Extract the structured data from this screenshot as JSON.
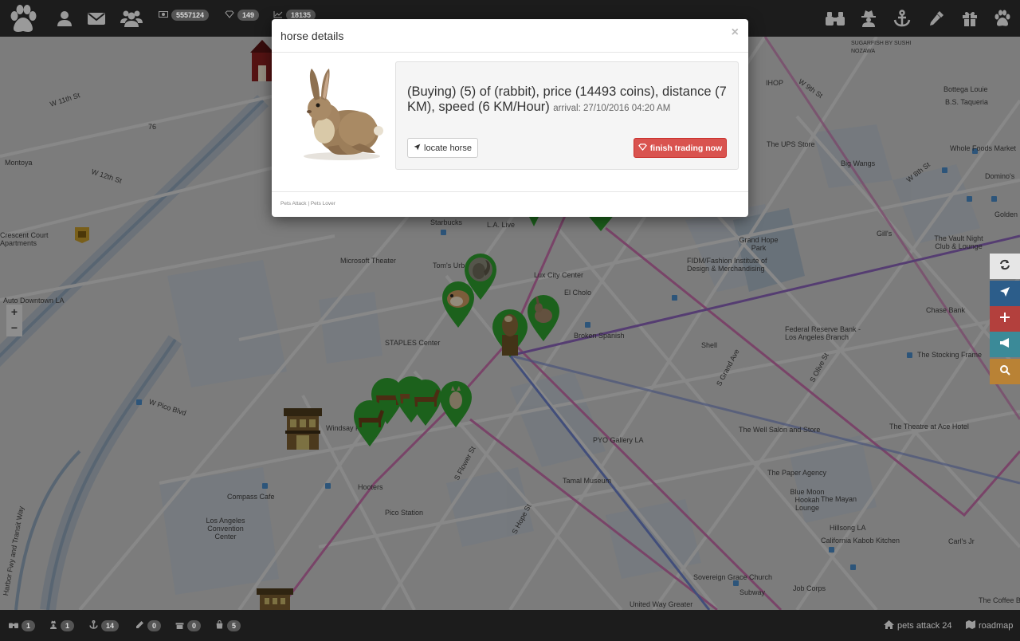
{
  "topbar": {
    "icons_left": [
      "paw-icon",
      "user-icon",
      "envelope-icon",
      "users-icon"
    ],
    "stats": [
      {
        "icon": "money-icon",
        "value": "5557124"
      },
      {
        "icon": "diamond-icon",
        "value": "149"
      },
      {
        "icon": "chart-icon",
        "value": "18135"
      }
    ],
    "icons_right": [
      "binoculars-icon",
      "user-secret-icon",
      "anchor-icon",
      "eyedropper-icon",
      "gift-icon",
      "paw-icon"
    ]
  },
  "modal": {
    "title": "horse details",
    "close": "×",
    "main_text": "(Buying) (5) of (rabbit), price (14493 coins), distance (7 KM), speed (6 KM/Hour)",
    "arrival_text": "arrival: 27/10/2016 04:20 AM",
    "locate_label": "locate horse",
    "finish_label": "finish trading now",
    "footer": "Pets Attack | Pets Lover"
  },
  "map": {
    "labels": [
      {
        "text": "Microsoft Theater"
      },
      {
        "text": "STAPLES Center"
      },
      {
        "text": "Tom's Urban"
      },
      {
        "text": "Lux City Center"
      },
      {
        "text": "El Cholo"
      },
      {
        "text": "Broken Spanish"
      },
      {
        "text": "L.A. Live"
      },
      {
        "text": "Starbucks"
      },
      {
        "text": "Grand Hope Park"
      },
      {
        "text": "FIDM/Fashion Institute of Design & Merchandising"
      },
      {
        "text": "Federal Reserve Bank - Los Angeles Branch"
      },
      {
        "text": "Chase Bank"
      },
      {
        "text": "The Stocking Frame"
      },
      {
        "text": "Shell"
      },
      {
        "text": "The Well Salon and Store"
      },
      {
        "text": "The Theatre at Ace Hotel"
      },
      {
        "text": "PYO Gallery LA"
      },
      {
        "text": "The Paper Agency"
      },
      {
        "text": "Blue Moon Hookah Lounge"
      },
      {
        "text": "The Mayan"
      },
      {
        "text": "Hillsong LA"
      },
      {
        "text": "California Kabob Kitchen"
      },
      {
        "text": "Carl's Jr"
      },
      {
        "text": "Tamal Museum"
      },
      {
        "text": "Hooters"
      },
      {
        "text": "Pico Station"
      },
      {
        "text": "Compass Cafe"
      },
      {
        "text": "Los Angeles Convention Center"
      },
      {
        "text": "Sovereign Grace Church"
      },
      {
        "text": "Subway"
      },
      {
        "text": "Job Corps"
      },
      {
        "text": "United Way Greater"
      },
      {
        "text": "The Coffee Bean"
      },
      {
        "text": "Big Wangs"
      },
      {
        "text": "Gill's"
      },
      {
        "text": "The Vault Night Club & Lounge"
      },
      {
        "text": "Golden"
      },
      {
        "text": "Domino's"
      },
      {
        "text": "Whole Foods Market"
      },
      {
        "text": "The UPS Store"
      },
      {
        "text": "Bottega Louie"
      },
      {
        "text": "B.S. Taqueria"
      },
      {
        "text": "SUGARFISH BY SUSHI NOZAWA"
      },
      {
        "text": "IHOP"
      },
      {
        "text": "Auto Downtown LA"
      },
      {
        "text": "Crescent Court Apartments"
      },
      {
        "text": "Montoya"
      },
      {
        "text": "Windsay Plaza"
      },
      {
        "text": "Harbor Fwy and Transit Way"
      },
      {
        "text": "W Pico Blvd"
      },
      {
        "text": "W 11th St"
      },
      {
        "text": "W 12th St"
      },
      {
        "text": "S Flower St"
      },
      {
        "text": "S Grand Ave"
      },
      {
        "text": "S Hope St"
      },
      {
        "text": "S Olive St"
      },
      {
        "text": "W 9th St"
      },
      {
        "text": "W 8th St"
      },
      {
        "text": "76"
      }
    ]
  },
  "right_controls": [
    "refresh-icon",
    "location-arrow-icon",
    "plus-icon",
    "bullhorn-icon",
    "search-icon"
  ],
  "right_colors": [
    "#e6e6e6",
    "#2c5d8a",
    "#b3403d",
    "#3b8a98",
    "#b98235"
  ],
  "bottombar": {
    "items": [
      {
        "icon": "binoculars-icon",
        "count": "1"
      },
      {
        "icon": "user-secret-icon",
        "count": "1"
      },
      {
        "icon": "anchor-icon",
        "count": "14"
      },
      {
        "icon": "eyedropper-icon",
        "count": "0"
      },
      {
        "icon": "gift-icon",
        "count": "0"
      },
      {
        "icon": "shopping-bag-icon",
        "count": "5"
      }
    ],
    "home_text": "pets attack 24",
    "roadmap_text": "roadmap"
  },
  "colors": {
    "accent_green": "#2e9d2e",
    "danger": "#d9534f"
  }
}
